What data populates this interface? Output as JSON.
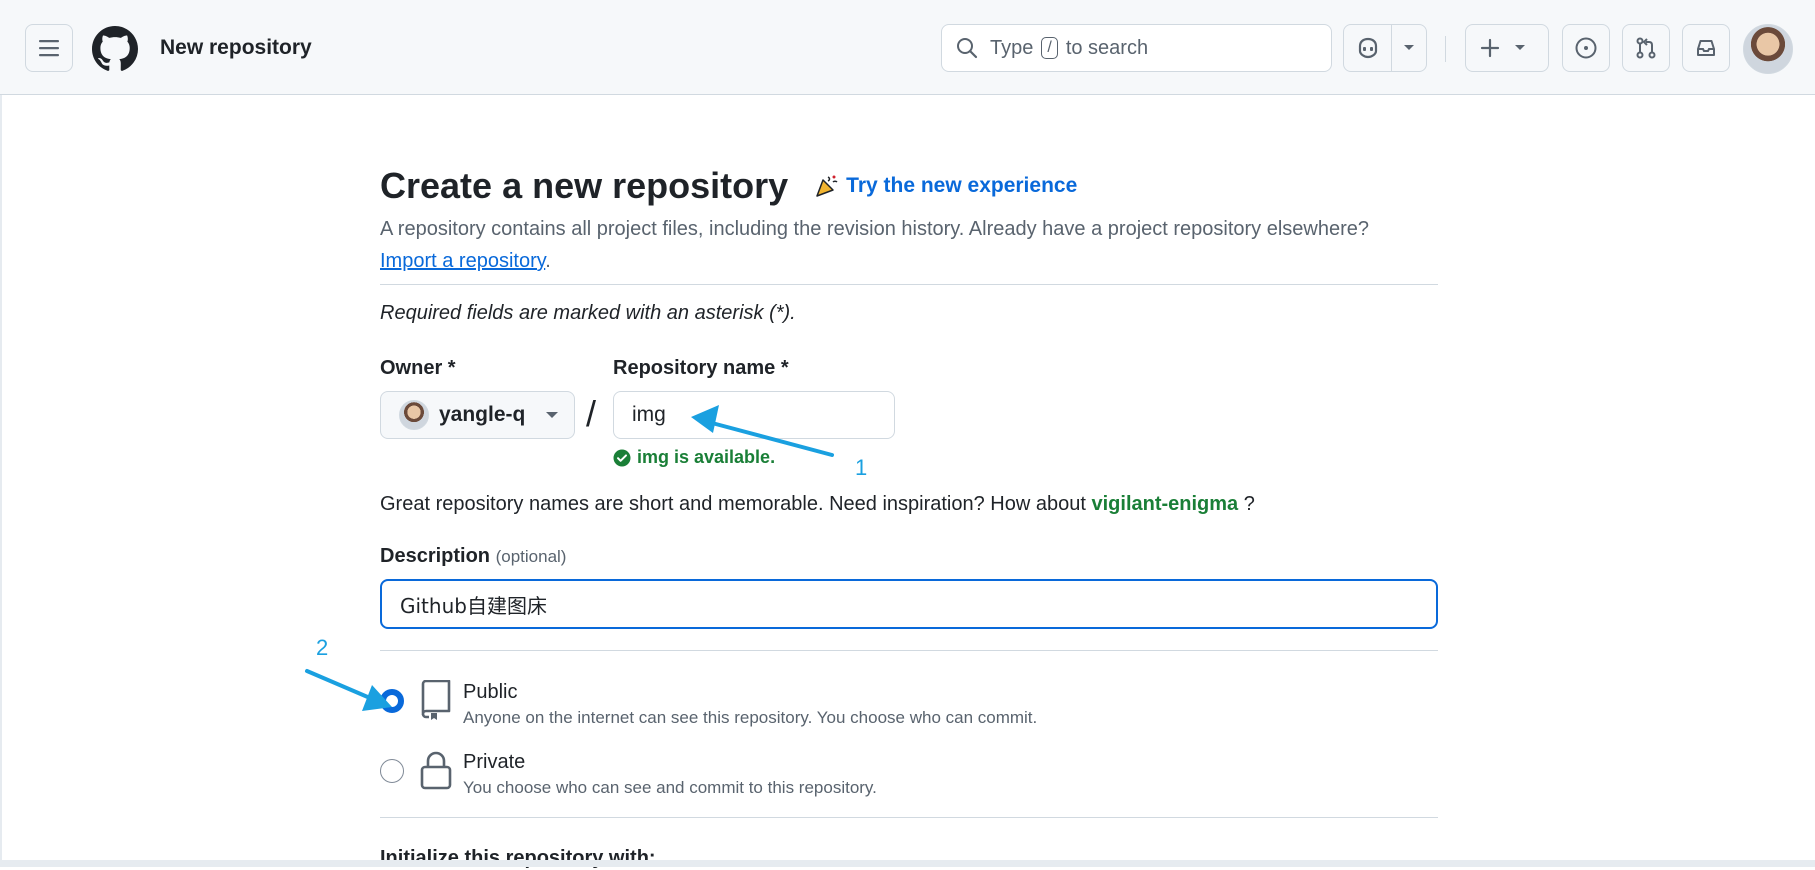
{
  "header": {
    "context_title": "New repository",
    "search": {
      "prefix": "Type",
      "key": "/",
      "suffix": "to search"
    }
  },
  "page": {
    "title": "Create a new repository",
    "try_link": "Try the new experience",
    "description": "A repository contains all project files, including the revision history. Already have a project repository elsewhere?",
    "import_link": "Import a repository",
    "import_suffix": ".",
    "required_note": "Required fields are marked with an asterisk (*)."
  },
  "form": {
    "owner_label": "Owner *",
    "owner_value": "yangle-q",
    "separator": "/",
    "repo_name_label": "Repository name *",
    "repo_name_value": "img",
    "availability": "img is available.",
    "suggestion_prefix": "Great repository names are short and memorable. Need inspiration? How about",
    "suggestion_name": "vigilant-enigma",
    "suggestion_suffix": "?",
    "description_label": "Description",
    "description_optional": "(optional)",
    "description_value": "Github自建图床",
    "visibility": [
      {
        "title": "Public",
        "subtitle": "Anyone on the internet can see this repository. You choose who can commit.",
        "selected": true
      },
      {
        "title": "Private",
        "subtitle": "You choose who can see and commit to this repository.",
        "selected": false
      }
    ],
    "initialize_label": "Initialize this repository with:"
  },
  "annotations": {
    "one": "1",
    "two": "2"
  },
  "colors": {
    "accent": "#0969da",
    "success": "#1a7f37",
    "annotation": "#1aa0e0"
  }
}
